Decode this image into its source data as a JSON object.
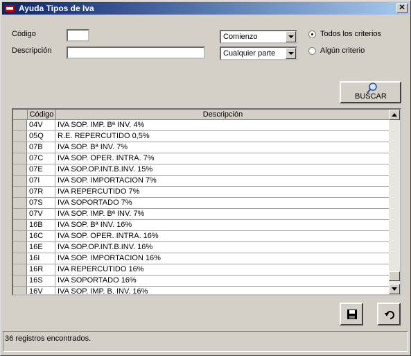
{
  "window": {
    "title": "Ayuda Tipos de Iva"
  },
  "form": {
    "codigo_label": "Código",
    "descripcion_label": "Descripción",
    "codigo_value": "",
    "descripcion_value": "",
    "match_select": "Comienzo",
    "part_select": "Cualquier parte",
    "radio_all": "Todos los criterios",
    "radio_any": "Algún criterio",
    "radio_selected": "all"
  },
  "search_button": {
    "label": "BUSCAR"
  },
  "grid": {
    "headers": [
      "Código",
      "Descripción"
    ],
    "rows": [
      {
        "code": "04V",
        "desc": "IVA SOP. IMP. Bª INV. 4%"
      },
      {
        "code": "05Q",
        "desc": "R.E. REPERCUTIDO 0,5%"
      },
      {
        "code": "07B",
        "desc": "IVA SOP. Bª INV. 7%"
      },
      {
        "code": "07C",
        "desc": "IVA SOP. OPER. INTRA. 7%"
      },
      {
        "code": "07E",
        "desc": "IVA SOP.OP.INT.B.INV. 15%"
      },
      {
        "code": "07I",
        "desc": "IVA SOP. IMPORTACION 7%"
      },
      {
        "code": "07R",
        "desc": "IVA REPERCUTIDO 7%"
      },
      {
        "code": "07S",
        "desc": "IVA SOPORTADO 7%"
      },
      {
        "code": "07V",
        "desc": "IVA SOP. IMP. Bª INV. 7%"
      },
      {
        "code": "16B",
        "desc": "IVA SOP. Bª INV. 16%"
      },
      {
        "code": "16C",
        "desc": "IVA SOP. OPER. INTRA. 16%"
      },
      {
        "code": "16E",
        "desc": "IVA SOP.OP.INT.B.INV. 16%"
      },
      {
        "code": "16I",
        "desc": "IVA SOP. IMPORTACION 16%"
      },
      {
        "code": "16R",
        "desc": "IVA REPERCUTIDO 16%"
      },
      {
        "code": "16S",
        "desc": "IVA SOPORTADO 16%"
      },
      {
        "code": "16V",
        "desc": "IVA SOP. IMP. B. INV. 16%"
      }
    ]
  },
  "status": {
    "text": "36 registros encontrados."
  },
  "icons": {
    "search": "magnifier-icon",
    "save": "floppy-save-icon",
    "undo": "undo-arrow-icon",
    "app": "app-icon"
  }
}
